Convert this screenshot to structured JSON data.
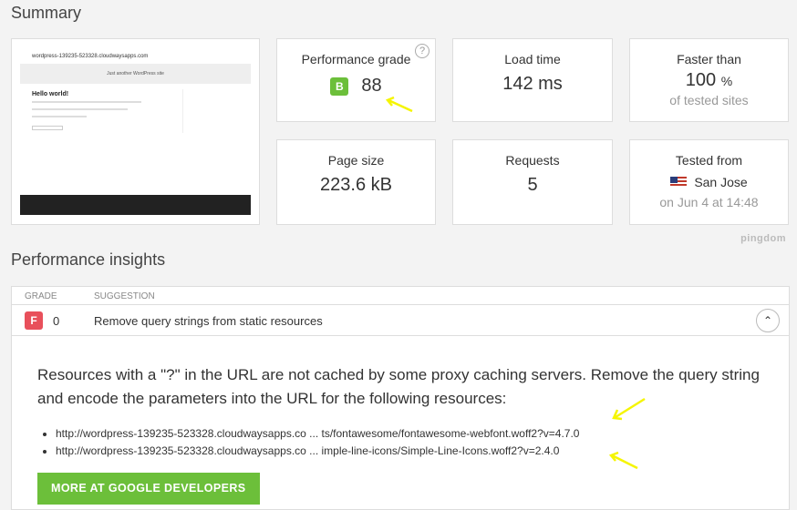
{
  "summary": {
    "title": "Summary",
    "thumbnail": {
      "site_url": "wordpress-139235-523328.cloudwaysapps.com",
      "tagline": "Just another WordPress site",
      "post_title": "Hello world!"
    },
    "performance_grade": {
      "label": "Performance grade",
      "letter": "B",
      "value": "88",
      "help": "?"
    },
    "load_time": {
      "label": "Load time",
      "value": "142 ms"
    },
    "faster_than": {
      "label": "Faster than",
      "value": "100",
      "unit": "%",
      "sub": "of tested sites"
    },
    "page_size": {
      "label": "Page size",
      "value": "223.6 kB"
    },
    "requests": {
      "label": "Requests",
      "value": "5"
    },
    "tested_from": {
      "label": "Tested from",
      "location": "San Jose",
      "date": "on Jun 4 at 14:48"
    }
  },
  "brand": "pingdom",
  "insights": {
    "title": "Performance insights",
    "columns": {
      "grade": "GRADE",
      "suggestion": "SUGGESTION"
    },
    "row": {
      "grade": "F",
      "score": "0",
      "suggestion": "Remove query strings from static resources",
      "toggle": "⌃"
    },
    "detail": {
      "text": "Resources with a \"?\" in the URL are not cached by some proxy caching servers. Remove the query string and encode the parameters into the URL for the following resources:",
      "resources": [
        "http://wordpress-139235-523328.cloudwaysapps.co ... ts/fontawesome/fontawesome-webfont.woff2?v=4.7.0",
        "http://wordpress-139235-523328.cloudwaysapps.co ... imple-line-icons/Simple-Line-Icons.woff2?v=2.4.0"
      ],
      "button": "MORE AT GOOGLE DEVELOPERS"
    }
  },
  "colors": {
    "grade_b": "#6cbf3a",
    "grade_f": "#e8505b",
    "annotation_arrow": "#f5f500"
  }
}
